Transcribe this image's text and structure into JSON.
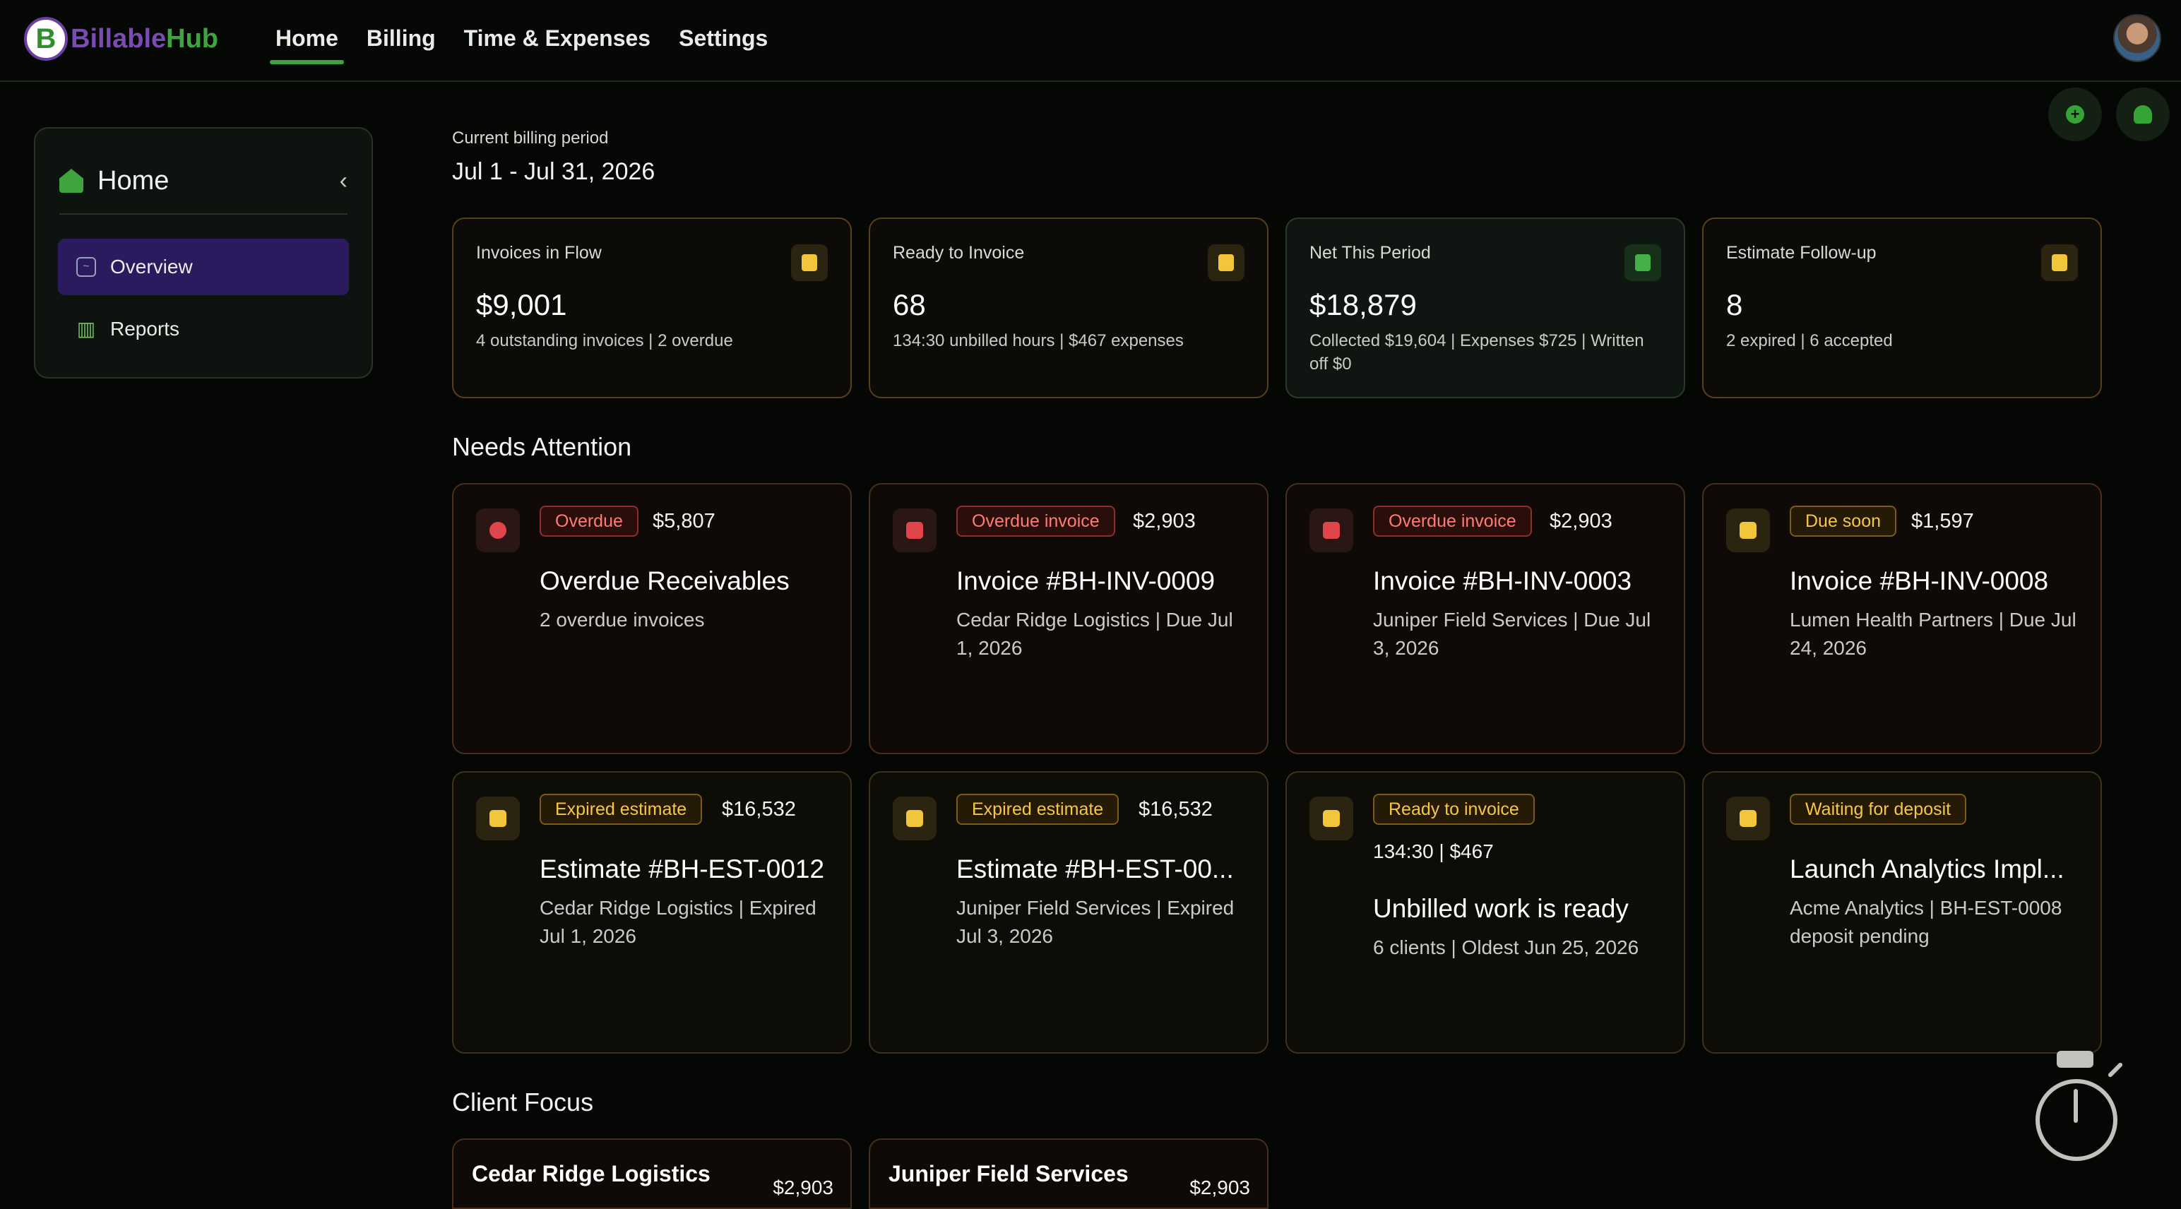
{
  "brand": {
    "name_part1": "Billable",
    "name_part2": "Hub",
    "mark": "B"
  },
  "nav": [
    {
      "label": "Home",
      "active": true
    },
    {
      "label": "Billing",
      "active": false
    },
    {
      "label": "Time & Expenses",
      "active": false
    },
    {
      "label": "Settings",
      "active": false
    }
  ],
  "sidebar": {
    "title": "Home",
    "collapse_icon": "chevron-left-icon",
    "items": [
      {
        "label": "Overview",
        "icon": "trend-chart-icon",
        "active": true
      },
      {
        "label": "Reports",
        "icon": "bar-chart-icon",
        "active": false
      }
    ]
  },
  "period": {
    "label": "Current billing period",
    "value": "Jul 1 - Jul 31, 2026"
  },
  "stats": [
    {
      "title": "Invoices in Flow",
      "value": "$9,001",
      "sub": "4 outstanding invoices | 2 overdue",
      "icon": "invoice-list-icon",
      "tone": "amber"
    },
    {
      "title": "Ready to Invoice",
      "value": "68",
      "sub": "134:30 unbilled hours | $467 expenses",
      "icon": "receipt-check-icon",
      "tone": "amber"
    },
    {
      "title": "Net This Period",
      "value": "$18,879",
      "sub": "Collected $19,604 | Expenses $725 | Written off $0",
      "icon": "trend-up-icon",
      "tone": "green"
    },
    {
      "title": "Estimate Follow-up",
      "value": "8",
      "sub": "2 expired | 6 accepted",
      "icon": "document-icon",
      "tone": "amber"
    }
  ],
  "needs_attention": {
    "title": "Needs Attention",
    "cards": [
      {
        "pill": "Overdue",
        "amount": "$5,807",
        "title": "Overdue Receivables",
        "sub": "2 overdue invoices",
        "tone": "red",
        "icon": "alarm-clock-icon"
      },
      {
        "pill": "Overdue invoice",
        "amount": "$2,903",
        "title": "Invoice #BH-INV-0009",
        "sub": "Cedar Ridge Logistics | Due Jul 1, 2026",
        "tone": "red",
        "icon": "receipt-alert-icon"
      },
      {
        "pill": "Overdue invoice",
        "amount": "$2,903",
        "title": "Invoice #BH-INV-0003",
        "sub": "Juniper Field Services | Due Jul 3, 2026",
        "tone": "red",
        "icon": "receipt-x-icon"
      },
      {
        "pill": "Due soon",
        "amount": "$1,597",
        "title": "Invoice #BH-INV-0008",
        "sub": "Lumen Health Partners | Due Jul 24, 2026",
        "tone": "yel",
        "icon": "calendar-icon"
      },
      {
        "pill": "Expired estimate",
        "amount": "$16,532",
        "title": "Estimate #BH-EST-0012",
        "sub": "Cedar Ridge Logistics | Expired Jul 1, 2026",
        "tone": "yel",
        "icon": "document-icon"
      },
      {
        "pill": "Expired estimate",
        "amount": "$16,532",
        "title": "Estimate #BH-EST-00...",
        "sub": "Juniper Field Services | Expired Jul 3, 2026",
        "tone": "yel",
        "icon": "document-icon"
      },
      {
        "pill": "Ready to invoice",
        "amount": "",
        "meta": "134:30 | $467",
        "title": "Unbilled work is ready",
        "sub": "6 clients | Oldest Jun 25, 2026",
        "tone": "yel",
        "icon": "receipt-check-icon"
      },
      {
        "pill": "Waiting for deposit",
        "amount": "",
        "title": "Launch Analytics Impl...",
        "sub": "Acme Analytics | BH-EST-0008 deposit pending",
        "tone": "yel",
        "icon": "briefcase-icon"
      }
    ]
  },
  "client_focus": {
    "title": "Client Focus",
    "clients": [
      {
        "name": "Cedar Ridge Logistics",
        "amount": "$2,903"
      },
      {
        "name": "Juniper Field Services",
        "amount": "$2,903"
      }
    ]
  },
  "actions": {
    "add_icon": "plus-circle-icon",
    "bell_icon": "bell-icon",
    "timer_icon": "stopwatch-icon"
  }
}
